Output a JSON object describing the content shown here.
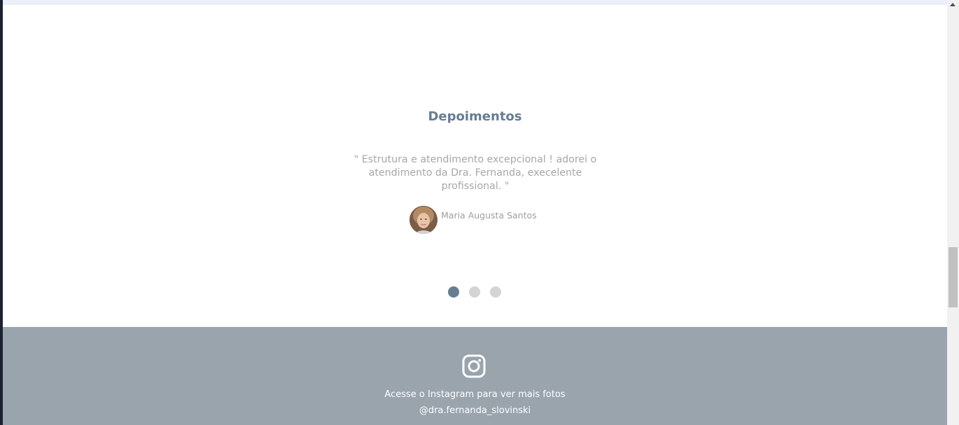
{
  "testimonials": {
    "title": "Depoimentos",
    "quote": "\" Estrutura e atendimento excepcional ! adorei o atendimento da Dra. Fernanda, execelente profissional. \"",
    "author": "Maria Augusta Santos",
    "slides": 3,
    "active_slide": 1
  },
  "footer": {
    "icon": "instagram-icon",
    "cta_text": "Acesse o Instagram para ver mais fotos",
    "handle": "@dra.fernanda_slovinski"
  },
  "colors": {
    "title": "#667c92",
    "quote_text": "#a7a7a7",
    "dot_active": "#687c92",
    "dot_inactive": "#d4d4d4",
    "footer_bg": "#99a4ad"
  }
}
